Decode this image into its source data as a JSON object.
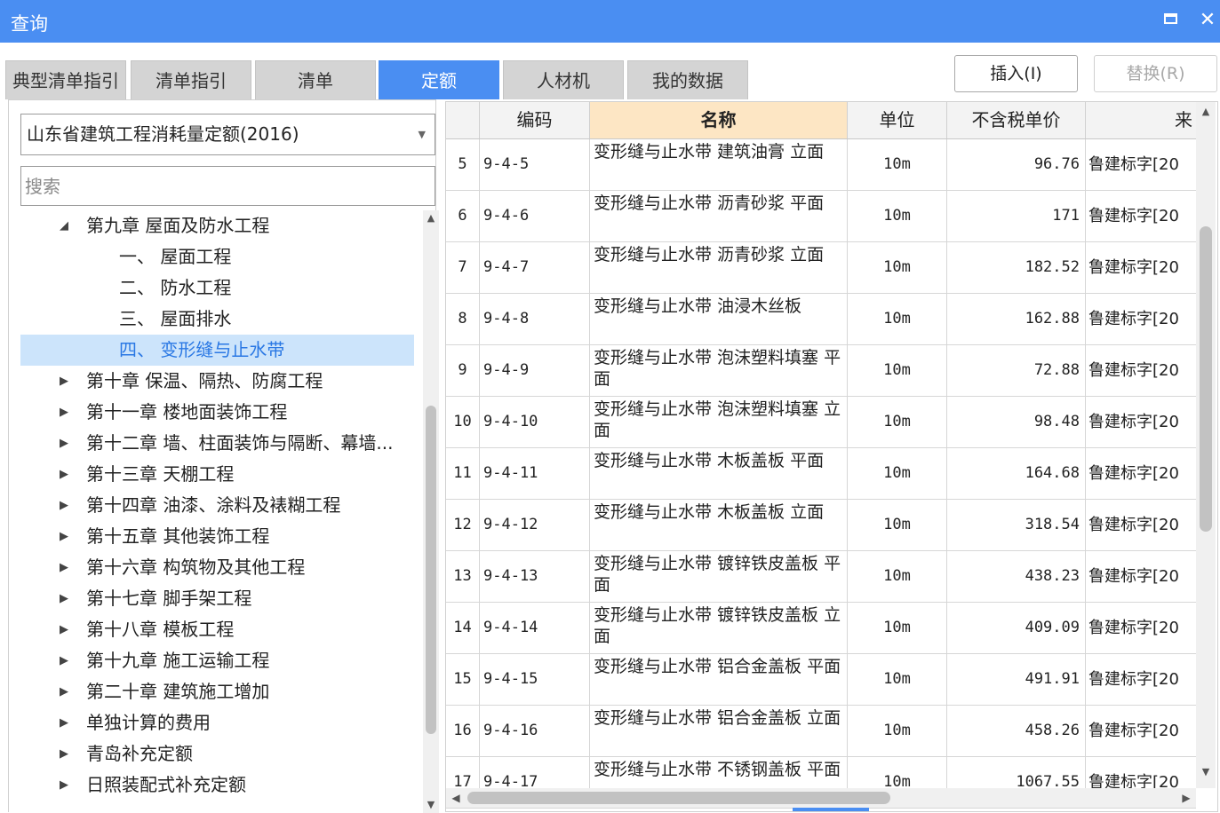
{
  "window": {
    "title": "查询",
    "restore_icon": "restore-icon",
    "close_symbol": "✕"
  },
  "tabs": [
    {
      "label": "典型清单指引",
      "active": false
    },
    {
      "label": "清单指引",
      "active": false
    },
    {
      "label": "清单",
      "active": false
    },
    {
      "label": "定额",
      "active": true
    },
    {
      "label": "人材机",
      "active": false
    },
    {
      "label": "我的数据",
      "active": false
    }
  ],
  "actions": {
    "insert_label": "插入(I)",
    "replace_label": "替换(R)"
  },
  "left": {
    "library_selected": "山东省建筑工程消耗量定额(2016)",
    "search_placeholder": "搜索",
    "tree": [
      {
        "toggle": "◢",
        "label": "第九章 屋面及防水工程",
        "level": 0,
        "selected": false
      },
      {
        "toggle": "",
        "label": "一、 屋面工程",
        "level": 1,
        "selected": false
      },
      {
        "toggle": "",
        "label": "二、 防水工程",
        "level": 1,
        "selected": false
      },
      {
        "toggle": "",
        "label": "三、 屋面排水",
        "level": 1,
        "selected": false
      },
      {
        "toggle": "",
        "label": "四、 变形缝与止水带",
        "level": 1,
        "selected": true
      },
      {
        "toggle": "▶",
        "label": "第十章 保温、隔热、防腐工程",
        "level": 0,
        "selected": false
      },
      {
        "toggle": "▶",
        "label": "第十一章 楼地面装饰工程",
        "level": 0,
        "selected": false
      },
      {
        "toggle": "▶",
        "label": "第十二章 墙、柱面装饰与隔断、幕墙...",
        "level": 0,
        "selected": false
      },
      {
        "toggle": "▶",
        "label": "第十三章 天棚工程",
        "level": 0,
        "selected": false
      },
      {
        "toggle": "▶",
        "label": "第十四章 油漆、涂料及裱糊工程",
        "level": 0,
        "selected": false
      },
      {
        "toggle": "▶",
        "label": "第十五章 其他装饰工程",
        "level": 0,
        "selected": false
      },
      {
        "toggle": "▶",
        "label": "第十六章 构筑物及其他工程",
        "level": 0,
        "selected": false
      },
      {
        "toggle": "▶",
        "label": "第十七章 脚手架工程",
        "level": 0,
        "selected": false
      },
      {
        "toggle": "▶",
        "label": "第十八章 模板工程",
        "level": 0,
        "selected": false
      },
      {
        "toggle": "▶",
        "label": "第十九章 施工运输工程",
        "level": 0,
        "selected": false
      },
      {
        "toggle": "▶",
        "label": "第二十章 建筑施工增加",
        "level": 0,
        "selected": false
      },
      {
        "toggle": "▶",
        "label": "单独计算的费用",
        "level": 0,
        "selected": false
      },
      {
        "toggle": "▶",
        "label": "青岛补充定额",
        "level": 0,
        "selected": false
      },
      {
        "toggle": "▶",
        "label": "日照装配式补充定额",
        "level": 0,
        "selected": false
      }
    ]
  },
  "grid": {
    "headers": [
      "",
      "编码",
      "名称",
      "单位",
      "不含税单价",
      "来"
    ],
    "rows": [
      {
        "num": "5",
        "code": "9-4-5",
        "name": "变形缝与止水带 建筑油膏 立面",
        "unit": "10m",
        "price": "96.76",
        "source": "鲁建标字[20"
      },
      {
        "num": "6",
        "code": "9-4-6",
        "name": "变形缝与止水带 沥青砂浆 平面",
        "unit": "10m",
        "price": "171",
        "source": "鲁建标字[20"
      },
      {
        "num": "7",
        "code": "9-4-7",
        "name": "变形缝与止水带 沥青砂浆 立面",
        "unit": "10m",
        "price": "182.52",
        "source": "鲁建标字[20"
      },
      {
        "num": "8",
        "code": "9-4-8",
        "name": "变形缝与止水带 油浸木丝板",
        "unit": "10m",
        "price": "162.88",
        "source": "鲁建标字[20"
      },
      {
        "num": "9",
        "code": "9-4-9",
        "name": "变形缝与止水带 泡沫塑料填塞 平面",
        "unit": "10m",
        "price": "72.88",
        "source": "鲁建标字[20"
      },
      {
        "num": "10",
        "code": "9-4-10",
        "name": "变形缝与止水带 泡沫塑料填塞 立面",
        "unit": "10m",
        "price": "98.48",
        "source": "鲁建标字[20"
      },
      {
        "num": "11",
        "code": "9-4-11",
        "name": "变形缝与止水带 木板盖板 平面",
        "unit": "10m",
        "price": "164.68",
        "source": "鲁建标字[20"
      },
      {
        "num": "12",
        "code": "9-4-12",
        "name": "变形缝与止水带 木板盖板 立面",
        "unit": "10m",
        "price": "318.54",
        "source": "鲁建标字[20"
      },
      {
        "num": "13",
        "code": "9-4-13",
        "name": "变形缝与止水带 镀锌铁皮盖板 平面",
        "unit": "10m",
        "price": "438.23",
        "source": "鲁建标字[20"
      },
      {
        "num": "14",
        "code": "9-4-14",
        "name": "变形缝与止水带 镀锌铁皮盖板 立面",
        "unit": "10m",
        "price": "409.09",
        "source": "鲁建标字[20"
      },
      {
        "num": "15",
        "code": "9-4-15",
        "name": "变形缝与止水带 铝合金盖板 平面",
        "unit": "10m",
        "price": "491.91",
        "source": "鲁建标字[20"
      },
      {
        "num": "16",
        "code": "9-4-16",
        "name": "变形缝与止水带 铝合金盖板 立面",
        "unit": "10m",
        "price": "458.26",
        "source": "鲁建标字[20"
      },
      {
        "num": "17",
        "code": "9-4-17",
        "name": "变形缝与止水带 不锈钢盖板 平面",
        "unit": "10m",
        "price": "1067.55",
        "source": "鲁建标字[20"
      }
    ]
  },
  "colors": {
    "accent": "#4a8ef2",
    "selected_bg": "#cce4fb",
    "name_header_bg": "#fde6c4"
  }
}
